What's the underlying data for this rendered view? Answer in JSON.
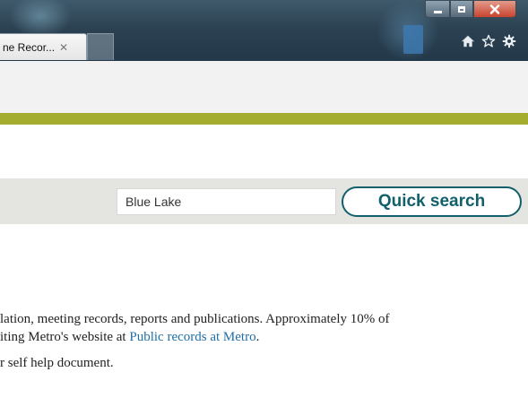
{
  "browser": {
    "tab": {
      "label": "ne Recor...",
      "close_glyph": "✕"
    },
    "window_controls": [
      "minimize",
      "maximize",
      "close"
    ],
    "toolbar_icons": [
      "home-icon",
      "star-icon",
      "gear-icon"
    ]
  },
  "search": {
    "input_value": "Blue Lake",
    "button_label": "Quick search"
  },
  "content": {
    "line1": "lation, meeting records, reports and publications. Approximately 10% of",
    "line2_prefix": "iting Metro's website at ",
    "line2_link": "Public records at Metro",
    "line2_suffix": ".",
    "line3": "r self help document."
  },
  "colors": {
    "accent_green": "#a5ad2f",
    "button_teal": "#12606b",
    "link_blue": "#1f6fa8",
    "search_band": "#e4e4e1"
  }
}
